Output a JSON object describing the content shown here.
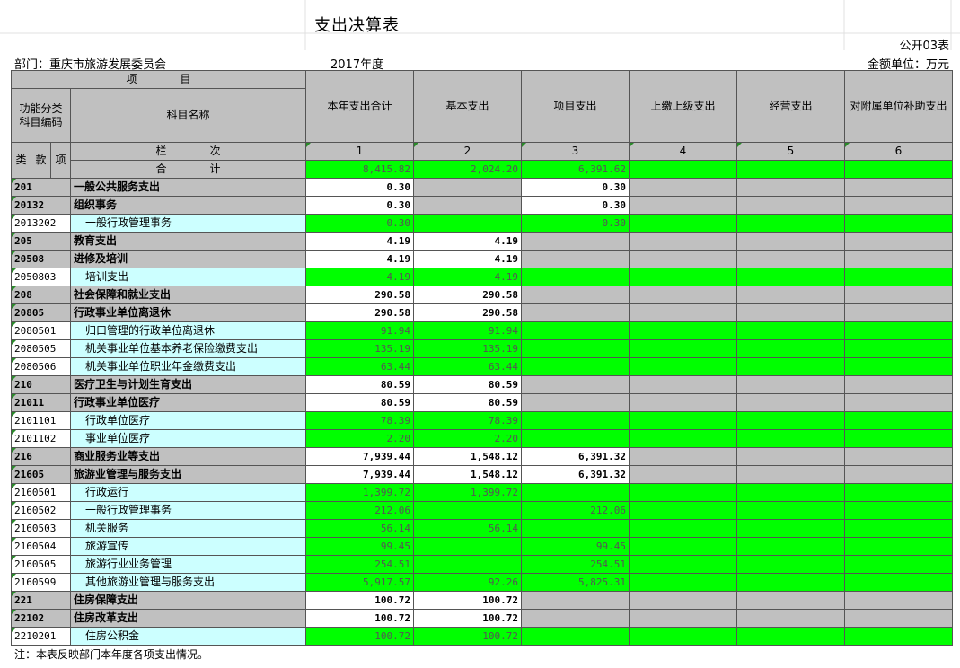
{
  "title": "支出决算表",
  "form_no": "公开03表",
  "dept": "部门：重庆市旅游发展委员会",
  "year": "2017年度",
  "unit": "金额单位：万元",
  "header": {
    "item_label": "项　　　　目",
    "func_code": "功能分类科目编码",
    "subject_name": "科目名称",
    "cols": [
      "本年支出合计",
      "基本支出",
      "项目支出",
      "上缴上级支出",
      "经营支出",
      "对附属单位补助支出"
    ],
    "lei": "类",
    "kuan": "款",
    "xiang": "项",
    "lanci": "栏　　　　次",
    "col_nums": [
      "1",
      "2",
      "3",
      "4",
      "5",
      "6"
    ],
    "total_label": "合　　　　计",
    "total": [
      "8,415.82",
      "2,024.20",
      "6,391.62",
      "",
      "",
      ""
    ]
  },
  "rows": [
    {
      "code": "201",
      "name": "一般公共服务支出",
      "level": 1,
      "v": [
        "0.30",
        "",
        "0.30"
      ]
    },
    {
      "code": "20132",
      "name": "组织事务",
      "level": 2,
      "v": [
        "0.30",
        "",
        "0.30"
      ]
    },
    {
      "code": "2013202",
      "name": "一般行政管理事务",
      "level": 3,
      "v": [
        "0.30",
        "",
        "0.30"
      ]
    },
    {
      "code": "205",
      "name": "教育支出",
      "level": 1,
      "v": [
        "4.19",
        "4.19",
        ""
      ]
    },
    {
      "code": "20508",
      "name": "进修及培训",
      "level": 2,
      "v": [
        "4.19",
        "4.19",
        ""
      ]
    },
    {
      "code": "2050803",
      "name": "培训支出",
      "level": 3,
      "v": [
        "4.19",
        "4.19",
        ""
      ]
    },
    {
      "code": "208",
      "name": "社会保障和就业支出",
      "level": 1,
      "v": [
        "290.58",
        "290.58",
        ""
      ]
    },
    {
      "code": "20805",
      "name": "行政事业单位离退休",
      "level": 2,
      "v": [
        "290.58",
        "290.58",
        ""
      ]
    },
    {
      "code": "2080501",
      "name": "归口管理的行政单位离退休",
      "level": 3,
      "v": [
        "91.94",
        "91.94",
        ""
      ]
    },
    {
      "code": "2080505",
      "name": "机关事业单位基本养老保险缴费支出",
      "level": 3,
      "v": [
        "135.19",
        "135.19",
        ""
      ]
    },
    {
      "code": "2080506",
      "name": "机关事业单位职业年金缴费支出",
      "level": 3,
      "v": [
        "63.44",
        "63.44",
        ""
      ]
    },
    {
      "code": "210",
      "name": "医疗卫生与计划生育支出",
      "level": 1,
      "v": [
        "80.59",
        "80.59",
        ""
      ]
    },
    {
      "code": "21011",
      "name": "行政事业单位医疗",
      "level": 2,
      "v": [
        "80.59",
        "80.59",
        ""
      ]
    },
    {
      "code": "2101101",
      "name": "行政单位医疗",
      "level": 3,
      "v": [
        "78.39",
        "78.39",
        ""
      ]
    },
    {
      "code": "2101102",
      "name": "事业单位医疗",
      "level": 3,
      "v": [
        "2.20",
        "2.20",
        ""
      ]
    },
    {
      "code": "216",
      "name": "商业服务业等支出",
      "level": 1,
      "v": [
        "7,939.44",
        "1,548.12",
        "6,391.32"
      ]
    },
    {
      "code": "21605",
      "name": "旅游业管理与服务支出",
      "level": 2,
      "v": [
        "7,939.44",
        "1,548.12",
        "6,391.32"
      ]
    },
    {
      "code": "2160501",
      "name": "行政运行",
      "level": 3,
      "v": [
        "1,399.72",
        "1,399.72",
        ""
      ]
    },
    {
      "code": "2160502",
      "name": "一般行政管理事务",
      "level": 3,
      "v": [
        "212.06",
        "",
        "212.06"
      ]
    },
    {
      "code": "2160503",
      "name": "机关服务",
      "level": 3,
      "v": [
        "56.14",
        "56.14",
        ""
      ]
    },
    {
      "code": "2160504",
      "name": "旅游宣传",
      "level": 3,
      "v": [
        "99.45",
        "",
        "99.45"
      ]
    },
    {
      "code": "2160505",
      "name": "旅游行业业务管理",
      "level": 3,
      "v": [
        "254.51",
        "",
        "254.51"
      ]
    },
    {
      "code": "2160599",
      "name": "其他旅游业管理与服务支出",
      "level": 3,
      "v": [
        "5,917.57",
        "92.26",
        "5,825.31"
      ]
    },
    {
      "code": "221",
      "name": "住房保障支出",
      "level": 1,
      "v": [
        "100.72",
        "100.72",
        ""
      ]
    },
    {
      "code": "22102",
      "name": "住房改革支出",
      "level": 2,
      "v": [
        "100.72",
        "100.72",
        ""
      ]
    },
    {
      "code": "2210201",
      "name": "住房公积金",
      "level": 3,
      "v": [
        "100.72",
        "100.72",
        ""
      ]
    }
  ],
  "note": "注：本表反映部门本年度各项支出情况。",
  "colors": {
    "green": "#00ff00",
    "gray": "#c0c0c0",
    "cyan": "#ccffff"
  }
}
